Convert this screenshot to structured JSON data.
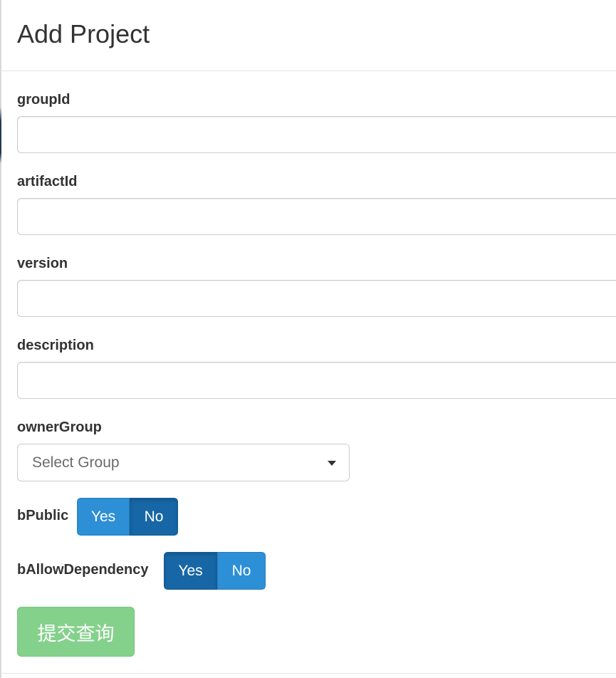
{
  "modal": {
    "title": "Add Project"
  },
  "fields": {
    "groupId": {
      "label": "groupId",
      "value": ""
    },
    "artifactId": {
      "label": "artifactId",
      "value": ""
    },
    "version": {
      "label": "version",
      "value": ""
    },
    "description": {
      "label": "description",
      "value": ""
    }
  },
  "ownerGroup": {
    "label": "ownerGroup",
    "selected": "Select Group"
  },
  "bPublic": {
    "label": "bPublic",
    "yes": "Yes",
    "no": "No",
    "active": "No"
  },
  "bAllowDependency": {
    "label": "bAllowDependency",
    "yes": "Yes",
    "no": "No",
    "active": "Yes"
  },
  "submit": {
    "label": "提交查询"
  },
  "colors": {
    "toggle_active": "#1767a6",
    "toggle_inactive": "#2d8fd6",
    "submit_bg": "#84d18c"
  }
}
